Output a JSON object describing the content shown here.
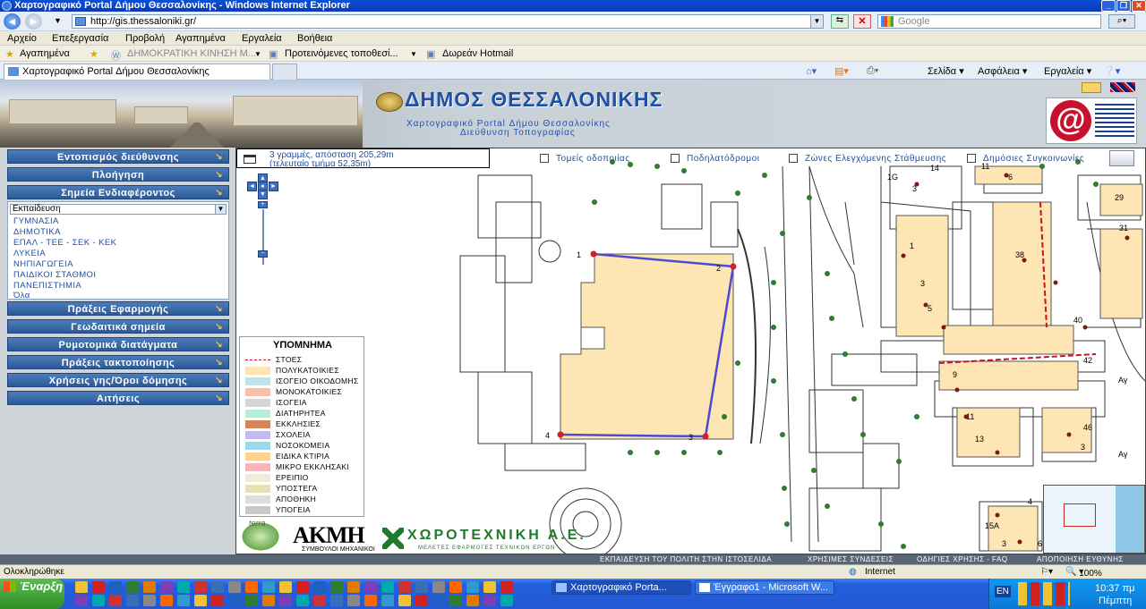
{
  "window": {
    "title": "Χαρτογραφικό Portal Δήμου Θεσσαλονίκης - Windows Internet Explorer"
  },
  "browser": {
    "address": "http://gis.thessaloniki.gr/",
    "search_placeholder": "Google",
    "menu": [
      "Αρχείο",
      "Επεξεργασία",
      "Προβολή",
      "Αγαπημένα",
      "Εργαλεία",
      "Βοήθεια"
    ],
    "favorites": {
      "label": "Αγαπημένα",
      "links": [
        "ΔΗΜΟΚΡΑΤΙΚΗ ΚΙΝΗΣΗ Μ...",
        "Προτεινόμενες τοποθεσί...",
        "Δωρεάν Hotmail"
      ]
    },
    "tab": "Χαρτογραφικό Portal Δήμου Θεσσαλονίκης",
    "tools": [
      "Σελίδα",
      "Ασφάλεια",
      "Εργαλεία"
    ]
  },
  "header": {
    "title": "ΔΗΜΟΣ ΘΕΣΣΑΛΟΝΙΚΗΣ",
    "subtitle1": "Χαρτογραφικό Portal Δήμου Θεσσαλονίκης",
    "subtitle2": "Διεύθυνση Τοπογραφίας"
  },
  "sidebar": {
    "buttons_top": [
      "Εντοπισμός διεύθυνσης",
      "Πλοήγηση",
      "Σημεία Ενδιαφέροντος"
    ],
    "poi_select": "Εκπαίδευση",
    "poi_items": [
      "ΓΥΜΝΑΣΙΑ",
      "ΔΗΜΟΤΙΚΑ",
      "ΕΠΑΛ - ΤΕΕ - ΣΕΚ - ΚΕΚ",
      "ΛΥΚΕΙΑ",
      "ΝΗΠΙΑΓΩΓΕΙΑ",
      "ΠΑΙΔΙΚΟΙ ΣΤΑΘΜΟΙ",
      "ΠΑΝΕΠΙΣΤΗΜΙΑ",
      "Όλα"
    ],
    "buttons_bottom": [
      "Πράξεις Εφαρμογής",
      "Γεωδαιτικά σημεία",
      "Ρυμοτομικά διατάγματα",
      "Πράξεις τακτοποίησης",
      "Χρήσεις γης/Όροι δόμησης",
      "Αιτήσεις"
    ]
  },
  "map": {
    "measure_line1": "3 γραμμές, απόσταση 205,29m",
    "measure_line2": "(τελευταίο τμήμα 52,35m)",
    "layers": [
      "Τομείς οδοποιίας",
      "Ποδηλατόδρομοι",
      "Ζώνες Ελεγχόμενης Στάθμευσης",
      "Δημόσιες Συγκοινωνίες"
    ],
    "vertex_labels": [
      "1",
      "2",
      "3",
      "4"
    ],
    "parcel_labels": [
      "1G",
      "3",
      "14",
      "11",
      "6",
      "29",
      "31",
      "1",
      "3",
      "5",
      "38",
      "40",
      "42",
      "9",
      "11",
      "13",
      "3",
      "46",
      "4",
      "15A",
      "3",
      "6"
    ],
    "street_labels": [
      "Αγ",
      "Αγ"
    ]
  },
  "legend": {
    "title": "ΥΠΟΜΝΗΜΑ",
    "items": [
      {
        "label": "ΣΤΟΕΣ",
        "color": "#ffffff"
      },
      {
        "label": "ΠΟΛΥΚΑΤΟΙΚΙΕΣ",
        "color": "#fde6b3"
      },
      {
        "label": "ΙΣΟΓΕΙΟ ΟΙΚΟΔΟΜΗΣ",
        "color": "#bfe3e8"
      },
      {
        "label": "ΜΟΝΟΚΑΤΟΙΚΙΕΣ",
        "color": "#f8c1ae"
      },
      {
        "label": "ΙΣΟΓΕΙΑ",
        "color": "#d6d6d6"
      },
      {
        "label": "ΔΙΑΤΗΡΗΤΕΑ",
        "color": "#b9ecd5"
      },
      {
        "label": "ΕΚΚΛΗΣΙΕΣ",
        "color": "#d1875a"
      },
      {
        "label": "ΣΧΟΛΕΙΑ",
        "color": "#c7b9ef"
      },
      {
        "label": "ΝΟΣΟΚΟΜΕΙΑ",
        "color": "#9dd8ef"
      },
      {
        "label": "ΕΙΔΙΚΑ ΚΤΙΡΙΑ",
        "color": "#fbd38d"
      },
      {
        "label": "ΜΙΚΡΟ ΕΚΚΛΗΣΑΚΙ",
        "color": "#f5b6c2"
      },
      {
        "label": "ΕΡΕΙΠΙΟ",
        "color": "#f2ecd6"
      },
      {
        "label": "ΥΠΟΣΤΕΓΑ",
        "color": "#e6e2b8"
      },
      {
        "label": "ΑΠΟΘΗΚΗ",
        "color": "#dedede"
      },
      {
        "label": "ΥΠΟΓΕΙΑ",
        "color": "#c9c9c9"
      }
    ]
  },
  "logos": {
    "akmh": "ΑΚΜΗ",
    "akmh_sub": "ΣΥΜΒΟΥΛΟΙ ΜΗΧΑΝΙΚΟΙ",
    "xoro": "ΧΩΡΟΤΕΧΝΙΚΗ Α.Ε.",
    "xoro_sub": "ΜΕΛΕΤΕΣ ΕΦΑΡΜΟΓΕΣ ΤΕΧΝΙΚΩΝ ΕΡΓΩΝ",
    "terra": "terra"
  },
  "footer_links": [
    "ΕΚΠΑΙΔΕΥΣΗ ΤΟΥ ΠΟΛΙΤΗ ΣΤΗΝ ΙΣΤΟΣΕΛΙΔΑ",
    "ΧΡΗΣΙΜΕΣ ΣΥΝΔΕΣΕΙΣ",
    "ΟΔΗΓΙΕΣ ΧΡΗΣΗΣ - FAQ",
    "ΑΠΟΠΟΙΗΣΗ ΕΥΘΥΝΗΣ"
  ],
  "status": {
    "left": "Ολοκληρώθηκε",
    "zone": "Internet",
    "zoom": "100%"
  },
  "taskbar": {
    "start": "Έναρξη",
    "tasks": [
      "Χαρτογραφικό Porta...",
      "Έγγραφο1 - Microsoft W..."
    ],
    "lang": "EN",
    "time": "10:37 πμ",
    "day": "Πέμπτη"
  }
}
